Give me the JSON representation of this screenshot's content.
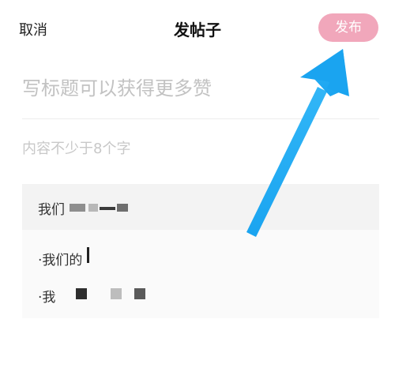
{
  "header": {
    "cancel_label": "取消",
    "title": "发帖子",
    "publish_label": "发布"
  },
  "editor": {
    "title_placeholder": "写标题可以获得更多赞",
    "content_placeholder": "内容不少于8个字"
  },
  "preview": {
    "heading": "我们",
    "lines": [
      "·我们的",
      "·我"
    ]
  },
  "colors": {
    "publish_button_bg": "#f1a7bb",
    "arrow": "#1aa4f0",
    "placeholder": "#c2c2c2"
  },
  "icons": {
    "annotation": "arrow-pointing-to-publish-button"
  }
}
